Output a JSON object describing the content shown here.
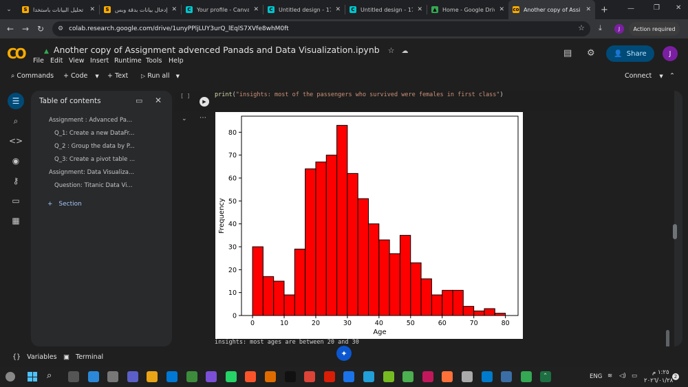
{
  "browser": {
    "tabs": [
      {
        "label": "تحليل البيانات باستخدا",
        "fav_color": "#f9ab00",
        "fav_glyph": "S"
      },
      {
        "label": "إدخال بيانات بدقة وبس",
        "fav_color": "#f9ab00",
        "fav_glyph": "S"
      },
      {
        "label": "Your profile - Canva",
        "fav_color": "#00c4cc",
        "fav_glyph": "C"
      },
      {
        "label": "Untitled design - 170",
        "fav_color": "#00c4cc",
        "fav_glyph": "C"
      },
      {
        "label": "Untitled design - 170",
        "fav_color": "#00c4cc",
        "fav_glyph": "C"
      },
      {
        "label": "Home - Google Drive",
        "fav_color": "#34a853",
        "fav_glyph": "▲"
      },
      {
        "label": "Another copy of Assi",
        "fav_color": "#f9ab00",
        "fav_glyph": "co",
        "active": true
      }
    ],
    "url": "colab.research.google.com/drive/1unyPPljLUY3urQ_lEqlS7XVfe8whM0ft",
    "action_required": "Action required",
    "profile_initial": "J"
  },
  "colab": {
    "logo": "CO",
    "title": "Another copy of Assignment advenced Panads and Data Visualization.ipynb",
    "menus": [
      "File",
      "Edit",
      "View",
      "Insert",
      "Runtime",
      "Tools",
      "Help"
    ],
    "share_label": "Share",
    "avatar_initial": "J",
    "toolbar": {
      "commands": "Commands",
      "code": "Code",
      "text": "Text",
      "run_all": "Run all",
      "connect": "Connect"
    }
  },
  "toc": {
    "title": "Table of contents",
    "items": [
      {
        "label": "Assignment : Advanced Pa...",
        "level": 1
      },
      {
        "label": "Q_1: Create a new DataFr...",
        "level": 2
      },
      {
        "label": "Q_2 : Group the data by P...",
        "level": 2
      },
      {
        "label": "Q_3: Create a pivot table ...",
        "level": 2
      },
      {
        "label": "Assignment: Data Visualiza...",
        "level": 1
      },
      {
        "label": "Question: Titanic Data Vi...",
        "level": 2
      }
    ],
    "add_section": "Section"
  },
  "cell": {
    "bracket": "[ ]",
    "code_func": "print",
    "code_open": "(",
    "code_string": "\"insights: most of the passengers who survived were females in first class\"",
    "code_close": ")",
    "output_text": "insights: most ages are between 20 and 30"
  },
  "bottom": {
    "variables": "Variables",
    "terminal": "Terminal"
  },
  "taskbar": {
    "lang": "ENG",
    "time": "١:٢٥ م",
    "date": "٢٠٢٦/٠١/٢٨",
    "notif": "2"
  },
  "colors": {
    "bar_fill": "#ff0000",
    "accent": "#004a77"
  },
  "chart_data": {
    "type": "bar",
    "xlabel": "Age",
    "ylabel": "Frequency",
    "bin_width": 3.33,
    "bin_starts": [
      0,
      3.33,
      6.66,
      10,
      13.33,
      16.66,
      20,
      23.33,
      26.66,
      30,
      33.33,
      36.66,
      40,
      43.33,
      46.66,
      50,
      53.33,
      56.66,
      60,
      63.33,
      66.66,
      70,
      73.33,
      76.66
    ],
    "values": [
      30,
      17,
      15,
      9,
      29,
      64,
      67,
      70,
      83,
      62,
      51,
      40,
      33,
      27,
      35,
      23,
      16,
      9,
      11,
      11,
      4,
      2,
      3,
      1
    ],
    "xlim": [
      -3.5,
      84
    ],
    "ylim": [
      0,
      87
    ],
    "xticks": [
      0,
      10,
      20,
      30,
      40,
      50,
      60,
      70,
      80
    ],
    "yticks": [
      0,
      10,
      20,
      30,
      40,
      50,
      60,
      70,
      80
    ],
    "grid": false
  }
}
